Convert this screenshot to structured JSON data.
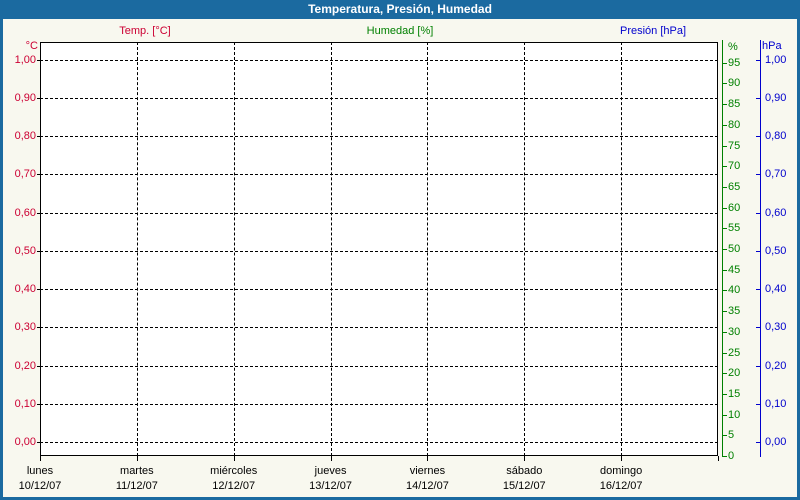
{
  "window": {
    "title": "Temperatura, Presión, Humedad"
  },
  "colors": {
    "frame_blue": "#1b6aa0",
    "temp_red": "#cc0033",
    "humidity_green": "#008000",
    "pressure_blue": "#0000cd",
    "background": "#f8f8ef",
    "plot_background": "#ffffff",
    "grid_black": "#000000"
  },
  "legend": [
    {
      "label": "Temp. [°C]",
      "color": "#cc0033"
    },
    {
      "label": "Humedad [%]",
      "color": "#008000"
    },
    {
      "label": "Presión [hPa]",
      "color": "#0000cd"
    }
  ],
  "axes": {
    "left": {
      "unit": "°C",
      "ticks": [
        "1,00",
        "0,90",
        "0,80",
        "0,70",
        "0,60",
        "0,50",
        "0,40",
        "0,30",
        "0,20",
        "0,10",
        "0,00"
      ]
    },
    "right_percent": {
      "unit": "%",
      "ticks": [
        "95",
        "90",
        "85",
        "80",
        "75",
        "70",
        "65",
        "60",
        "55",
        "50",
        "45",
        "40",
        "35",
        "30",
        "25",
        "20",
        "15",
        "10",
        "5",
        "0"
      ]
    },
    "right_hpa": {
      "unit": "hPa",
      "ticks": [
        "1,00",
        "0,90",
        "0,80",
        "0,70",
        "0,60",
        "0,50",
        "0,40",
        "0,30",
        "0,20",
        "0,10",
        "0,00"
      ]
    }
  },
  "x_axis": {
    "days": [
      {
        "name": "lunes",
        "date": "10/12/07"
      },
      {
        "name": "martes",
        "date": "11/12/07"
      },
      {
        "name": "miércoles",
        "date": "12/12/07"
      },
      {
        "name": "jueves",
        "date": "13/12/07"
      },
      {
        "name": "viernes",
        "date": "14/12/07"
      },
      {
        "name": "sábado",
        "date": "15/12/07"
      },
      {
        "name": "domingo",
        "date": "16/12/07"
      }
    ]
  },
  "chart_data": {
    "type": "line",
    "title": "Temperatura, Presión, Humedad",
    "x": {
      "categories": [
        "lunes 10/12/07",
        "martes 11/12/07",
        "miércoles 12/12/07",
        "jueves 13/12/07",
        "viernes 14/12/07",
        "sábado 15/12/07",
        "domingo 16/12/07"
      ]
    },
    "series": [
      {
        "name": "Temp. [°C]",
        "axis": "celsius",
        "color": "#cc0033",
        "values": []
      },
      {
        "name": "Humedad [%]",
        "axis": "percent",
        "color": "#008000",
        "values": []
      },
      {
        "name": "Presión [hPa]",
        "axis": "hpa",
        "color": "#0000cd",
        "values": []
      }
    ],
    "axes": {
      "celsius": {
        "label": "°C",
        "range": [
          0.0,
          1.0
        ],
        "step": 0.1,
        "decimal_separator": ","
      },
      "percent": {
        "label": "%",
        "range": [
          0,
          100
        ],
        "step": 5,
        "labeled_max": 95
      },
      "hpa": {
        "label": "hPa",
        "range": [
          0.0,
          1.0
        ],
        "step": 0.1,
        "decimal_separator": ","
      }
    },
    "grid": "dashed, horizontal at every 0,10 and vertical at every day boundary",
    "legend_position": "top",
    "plot_is_empty": true
  }
}
